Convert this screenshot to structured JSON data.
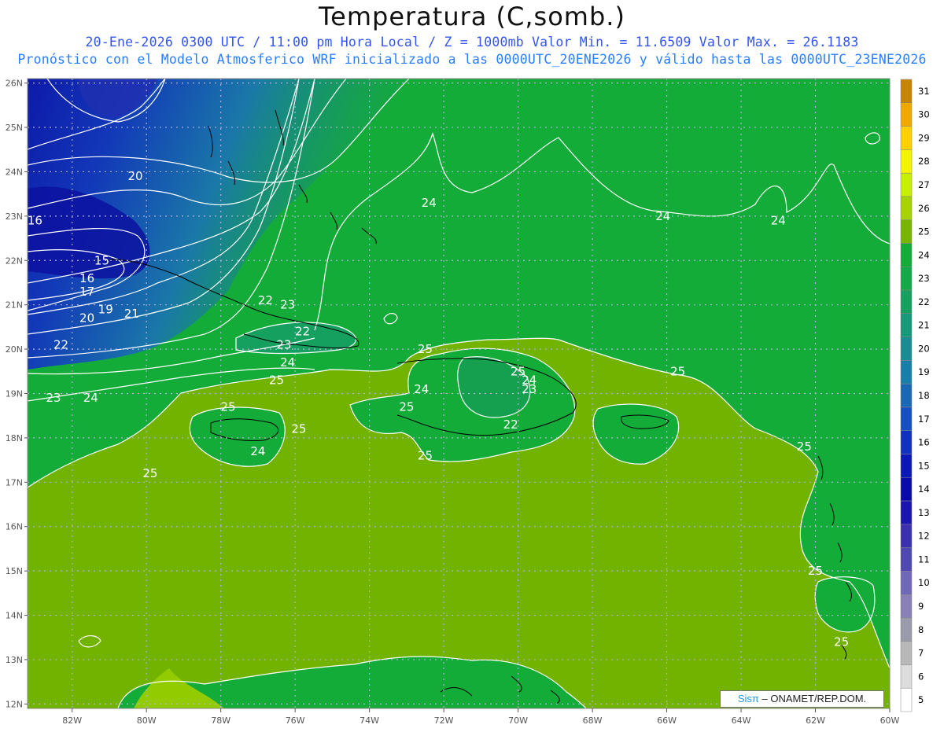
{
  "header": {
    "title": "Temperatura (C,somb.)",
    "line1": "20-Ene-2026 0300 UTC / 11:00 pm Hora Local / Z = 1000mb  Valor Min. = 11.6509  Valor Max. = 26.1183",
    "line2": "Pronóstico con el Modelo Atmosferico WRF inicializado a las 0000UTC_20ENE2026 y válido hasta las  0000UTC_23ENE2026"
  },
  "map": {
    "lon_range": [
      -83.2,
      -60
    ],
    "lat_range": [
      11.9,
      26.1
    ],
    "lon_ticks": [
      "82W",
      "80W",
      "78W",
      "76W",
      "74W",
      "72W",
      "70W",
      "68W",
      "66W",
      "64W",
      "62W",
      "60W"
    ],
    "lon_values": [
      -82,
      -80,
      -78,
      -76,
      -74,
      -72,
      -70,
      -68,
      -66,
      -64,
      -62,
      -60
    ],
    "lat_ticks": [
      "26N",
      "25N",
      "24N",
      "23N",
      "22N",
      "21N",
      "20N",
      "19N",
      "18N",
      "17N",
      "16N",
      "15N",
      "14N",
      "13N",
      "12N"
    ],
    "lat_values": [
      26,
      25,
      24,
      23,
      22,
      21,
      20,
      19,
      18,
      17,
      16,
      15,
      14,
      13,
      12
    ],
    "grid": true,
    "contour_labels": [
      {
        "text": "24",
        "lon": -72.4,
        "lat": 23.3
      },
      {
        "text": "24",
        "lon": -66.1,
        "lat": 23.0
      },
      {
        "text": "24",
        "lon": -63.0,
        "lat": 22.9
      },
      {
        "text": "20",
        "lon": -80.3,
        "lat": 23.9
      },
      {
        "text": "16",
        "lon": -83.0,
        "lat": 22.9
      },
      {
        "text": "15",
        "lon": -81.2,
        "lat": 22.0
      },
      {
        "text": "16",
        "lon": -81.6,
        "lat": 21.6
      },
      {
        "text": "17",
        "lon": -81.6,
        "lat": 21.3
      },
      {
        "text": "19",
        "lon": -81.1,
        "lat": 20.9
      },
      {
        "text": "21",
        "lon": -80.4,
        "lat": 20.8
      },
      {
        "text": "20",
        "lon": -81.6,
        "lat": 20.7
      },
      {
        "text": "22",
        "lon": -82.3,
        "lat": 20.1
      },
      {
        "text": "22",
        "lon": -76.8,
        "lat": 21.1
      },
      {
        "text": "23",
        "lon": -76.2,
        "lat": 21.0
      },
      {
        "text": "22",
        "lon": -75.8,
        "lat": 20.4
      },
      {
        "text": "23",
        "lon": -76.3,
        "lat": 20.1
      },
      {
        "text": "24",
        "lon": -76.2,
        "lat": 19.7
      },
      {
        "text": "25",
        "lon": -76.5,
        "lat": 19.3
      },
      {
        "text": "23",
        "lon": -82.5,
        "lat": 18.9
      },
      {
        "text": "24",
        "lon": -81.5,
        "lat": 18.9
      },
      {
        "text": "25",
        "lon": -77.8,
        "lat": 18.7
      },
      {
        "text": "25",
        "lon": -75.9,
        "lat": 18.2
      },
      {
        "text": "24",
        "lon": -77.0,
        "lat": 17.7
      },
      {
        "text": "25",
        "lon": -79.9,
        "lat": 17.2
      },
      {
        "text": "25",
        "lon": -72.5,
        "lat": 20.0
      },
      {
        "text": "24",
        "lon": -72.6,
        "lat": 19.1
      },
      {
        "text": "25",
        "lon": -73.0,
        "lat": 18.7
      },
      {
        "text": "25",
        "lon": -70.0,
        "lat": 19.5
      },
      {
        "text": "24",
        "lon": -69.7,
        "lat": 19.3
      },
      {
        "text": "23",
        "lon": -69.7,
        "lat": 19.1
      },
      {
        "text": "22",
        "lon": -70.2,
        "lat": 18.3
      },
      {
        "text": "25",
        "lon": -72.5,
        "lat": 17.6
      },
      {
        "text": "25",
        "lon": -65.7,
        "lat": 19.5
      },
      {
        "text": "25",
        "lon": -62.3,
        "lat": 17.8
      },
      {
        "text": "25",
        "lon": -62.0,
        "lat": 15.0
      },
      {
        "text": "25",
        "lon": -61.3,
        "lat": 13.4
      }
    ]
  },
  "colorbar": {
    "labels": [
      "5",
      "6",
      "7",
      "8",
      "9",
      "10",
      "11",
      "12",
      "13",
      "14",
      "15",
      "16",
      "17",
      "18",
      "19",
      "20",
      "21",
      "22",
      "23",
      "24",
      "25",
      "26",
      "27",
      "28",
      "29",
      "30",
      "31"
    ],
    "colors": [
      "#ffffff",
      "#dcdcdc",
      "#b8b8b8",
      "#9a9aaa",
      "#8a80b8",
      "#6f68b8",
      "#4f48b0",
      "#3a30b0",
      "#1c14b0",
      "#0a0aa8",
      "#0a18b8",
      "#1030c0",
      "#1450c0",
      "#1868b4",
      "#1880a8",
      "#188c90",
      "#179878",
      "#16a060",
      "#15a848",
      "#14ac38",
      "#78b400",
      "#a6d200",
      "#c6ee00",
      "#f4f400",
      "#ffd000",
      "#f0a800",
      "#c88400"
    ]
  },
  "credit": {
    "brand": "Sisπ",
    "text": "– ONAMET/REP.DOM."
  }
}
